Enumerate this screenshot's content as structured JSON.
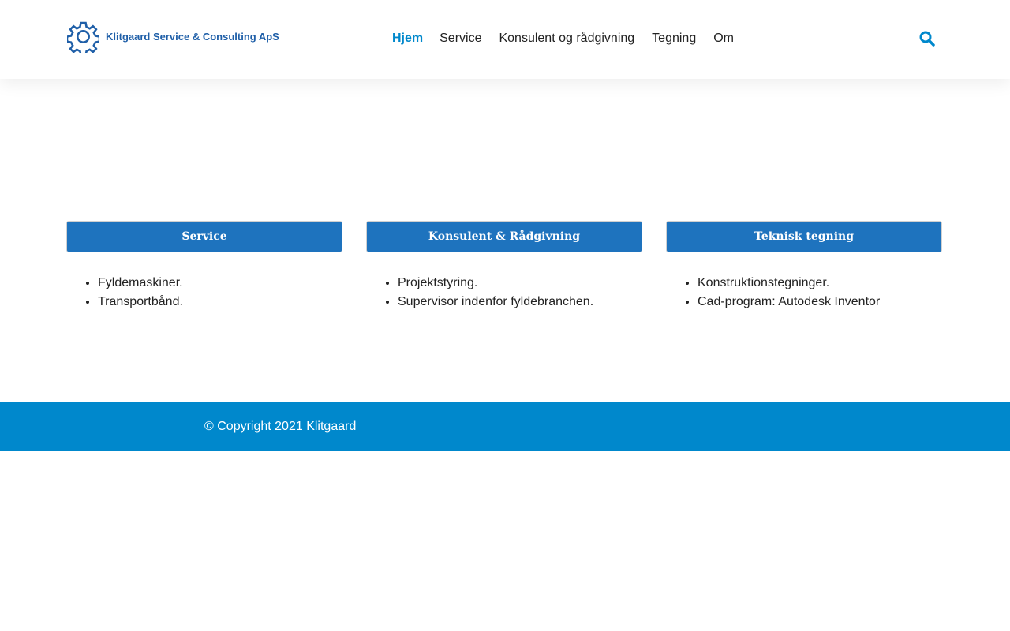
{
  "header": {
    "logo_text": "Klitgaard Service & Consulting ApS",
    "nav": [
      "Hjem",
      "Service",
      "Konsulent og rådgivning",
      "Tegning",
      "Om"
    ]
  },
  "columns": [
    {
      "title": "Service",
      "items": [
        "Fyldemaskiner.",
        "Transportbånd."
      ]
    },
    {
      "title": "Konsulent & Rådgivning",
      "items": [
        "Projektstyring.",
        "Supervisor indenfor fyldebranchen."
      ]
    },
    {
      "title": "Teknisk tegning",
      "items": [
        "Konstruktionstegninger.",
        "Cad-program: Autodesk Inventor"
      ]
    }
  ],
  "footer": {
    "copyright": "© Copyright 2021 Klitgaard"
  }
}
